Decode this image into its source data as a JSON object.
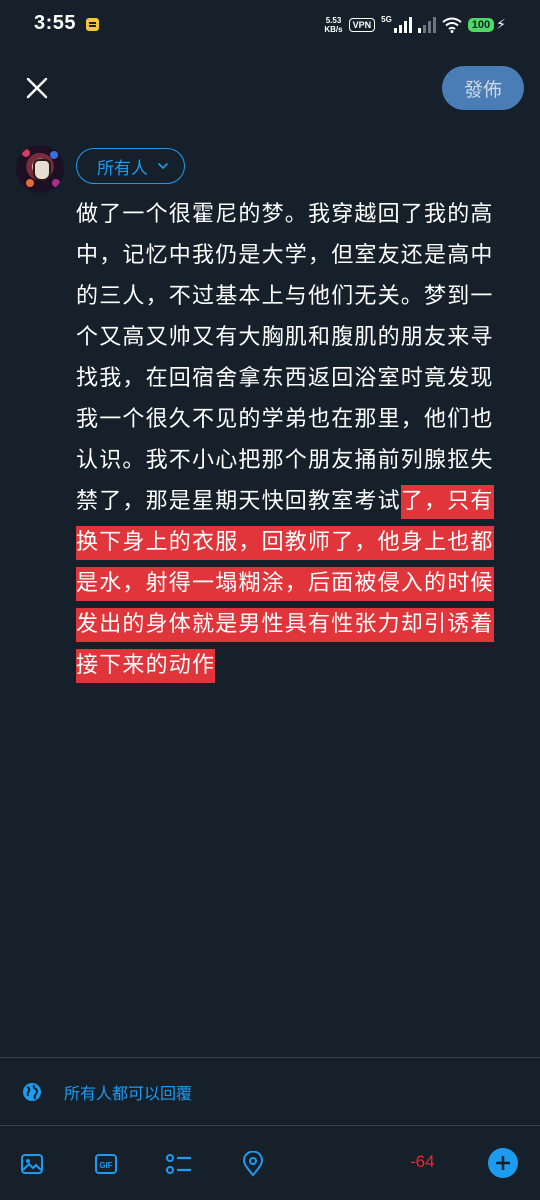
{
  "status_bar": {
    "time": "3:55",
    "speed_value": "5.53",
    "speed_unit": "KB/s",
    "vpn": "VPN",
    "network": "5G",
    "battery": "100"
  },
  "header": {
    "close_icon": "close-icon",
    "post_label": "發佈",
    "post_color": "#4a7cb5"
  },
  "composer": {
    "audience_label": "所有人",
    "text_normal": "做了一个很霍尼的梦。我穿越回了我的高中，记忆中我仍是大学，但室友还是高中的三人，不过基本上与他们无关。梦到一个又高又帅又有大胸肌和腹肌的朋友来寻找我，在回宿舍拿东西返回浴室时竟发现我一个很久不见的学弟也在那里，他们也认识。我不小心把那个朋友捅前列腺抠失禁了，那是星期天快回教室考试",
    "text_overflow": "了，只有换下身上的衣服，回教师了，他身上也都是水，射得一塌糊涂，后面被侵入的时候发出的身体就是男性具有性张力却引诱着接下来的动作",
    "overflow_color": "#e0363b"
  },
  "reply_setting": {
    "label": "所有人都可以回覆",
    "icon": "globe-icon"
  },
  "toolbar": {
    "icons": [
      "image-icon",
      "gif-icon",
      "poll-icon",
      "location-icon"
    ],
    "gif_text": "GIF",
    "char_counter": "-64",
    "add_icon": "add-icon"
  },
  "colors": {
    "background": "#15202b",
    "accent": "#1d9bf0",
    "warning": "#f4212e"
  }
}
